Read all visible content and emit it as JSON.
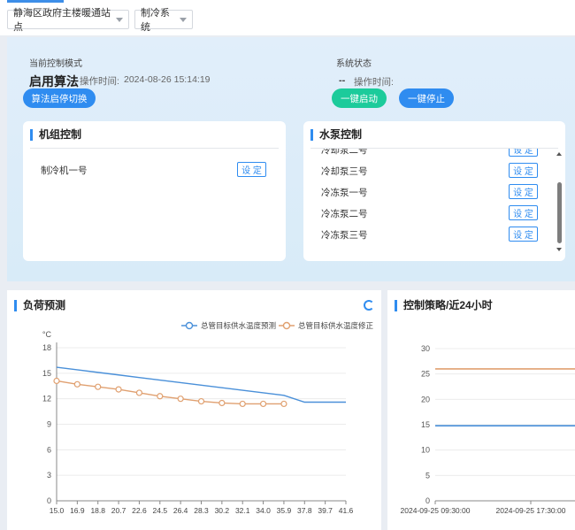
{
  "toolbar": {
    "station_select": "静海区政府主楼暖通站点",
    "system_select": "制冷系统"
  },
  "control": {
    "mode_label": "当前控制模式",
    "mode_value": "启用算法",
    "op_time_label": "操作时间:",
    "op_time_value": "2024-08-26 15:14:19",
    "switch_button": "算法启停切换",
    "status_label": "系统状态",
    "status_value": "--",
    "status_time_label": "操作时间:",
    "start_button": "一键启动",
    "stop_button": "一键停止"
  },
  "unit_card": {
    "title": "机组控制",
    "items": [
      {
        "label": "制冷机一号",
        "button": "设 定"
      }
    ]
  },
  "pump_card": {
    "title": "水泵控制",
    "items": [
      {
        "label": "冷却泵二号",
        "button": "设 定"
      },
      {
        "label": "冷却泵三号",
        "button": "设 定"
      },
      {
        "label": "冷冻泵一号",
        "button": "设 定"
      },
      {
        "label": "冷冻泵二号",
        "button": "设 定"
      },
      {
        "label": "冷冻泵三号",
        "button": "设 定"
      }
    ]
  },
  "load_panel": {
    "title": "负荷预测"
  },
  "strategy_panel": {
    "title": "控制策略/近24小时"
  },
  "colors": {
    "accent": "#2f8cf0",
    "start_green": "#1ccb9b",
    "series_blue": "#4a90d9",
    "series_orange": "#e0a070"
  },
  "chart_data": [
    {
      "type": "line",
      "ylabel": "°C",
      "ylim": [
        0,
        18
      ],
      "yticks": [
        0,
        3,
        6,
        9,
        12,
        15,
        18
      ],
      "categories": [
        "15.0",
        "16.9",
        "18.8",
        "20.7",
        "22.6",
        "24.5",
        "26.4",
        "28.3",
        "30.2",
        "32.1",
        "34.0",
        "35.9",
        "37.8",
        "39.7",
        "41.6"
      ],
      "legend_position": "top-right",
      "grid": "horizontal",
      "series": [
        {
          "name": "总管目标供水温度预测",
          "color": "#4a90d9",
          "markers": false,
          "values": [
            15.7,
            15.4,
            15.1,
            14.8,
            14.5,
            14.2,
            13.9,
            13.6,
            13.3,
            13.0,
            12.7,
            12.4,
            11.6,
            11.6,
            11.6
          ]
        },
        {
          "name": "总管目标供水温度修正",
          "color": "#e0a070",
          "markers": true,
          "values": [
            14.1,
            13.7,
            13.4,
            13.1,
            12.7,
            12.3,
            12.0,
            11.7,
            11.5,
            11.4,
            11.4,
            11.4,
            null,
            null,
            null
          ]
        }
      ]
    },
    {
      "type": "line",
      "ylim": [
        0,
        30
      ],
      "yticks": [
        0,
        5,
        10,
        15,
        20,
        25,
        30
      ],
      "xticks": [
        "2024-09-25 09:30:00",
        "2024-09-25 17:30:00"
      ],
      "grid": "horizontal",
      "series": [
        {
          "color": "#e0a070",
          "values": [
            26,
            26
          ]
        },
        {
          "color": "#4a90d9",
          "values": [
            14.8,
            14.8
          ]
        }
      ]
    }
  ]
}
